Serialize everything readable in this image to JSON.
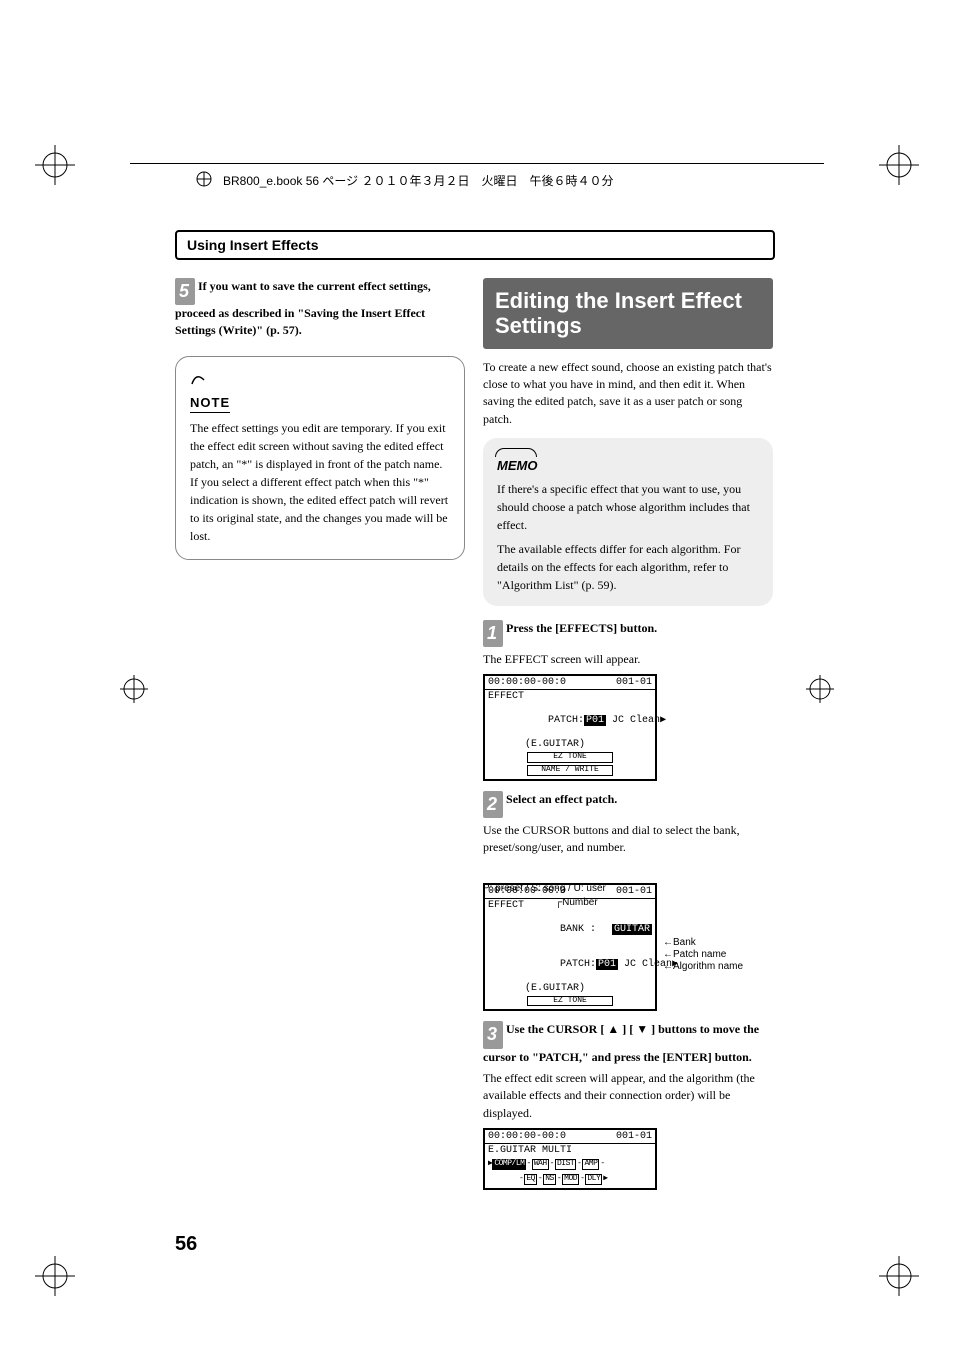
{
  "print_header": "BR800_e.book 56 ページ ２０１０年３月２日　火曜日　午後６時４０分",
  "section_header": "Using Insert Effects",
  "page_number": "56",
  "left": {
    "step5_num": "5",
    "step5_text": "If you want to save the current effect settings, proceed as described in \"Saving the Insert Effect Settings (Write)\" (p. 57).",
    "note_label": "NOTE",
    "note_text": "The effect settings you edit are temporary. If you exit the effect edit screen without saving the edited effect patch, an \"*\" is displayed in front of the patch name. If you select a different effect patch when this \"*\" indication is shown, the edited effect patch will revert to its original state, and the changes you made will be lost."
  },
  "right": {
    "title": "Editing the Insert Effect Settings",
    "intro": "To create a new effect sound, choose an existing patch that's close to what you have in mind, and then edit it. When saving the edited patch, save it as a user patch or song patch.",
    "memo_label": "MEMO",
    "memo_p1": "If there's a specific effect that you want to use, you should choose a patch whose algorithm includes that effect.",
    "memo_p2": "The available effects differ for each algorithm. For details on the effects for each algorithm, refer to \"Algorithm List\" (p. 59).",
    "step1_num": "1",
    "step1_bold": "Press the [EFFECTS] button.",
    "step1_text": "The EFFECT screen will appear.",
    "lcd1": {
      "top_left": "00:00:00-00:0",
      "top_right": "001-01",
      "l2": "EFFECT",
      "l3a": "PATCH:",
      "l3b": "P01",
      "l3c": " JC Clean",
      "l4": "(E.GUITAR)",
      "btn1": "EZ TONE",
      "btn2": "NAME / WRITE"
    },
    "step2_num": "2",
    "step2_bold": "Select an effect patch.",
    "step2_text": "Use the CURSOR buttons and dial to select the bank, preset/song/user, and number.",
    "anno_top": "P: preset / S: song / U: user",
    "anno_number": "Number",
    "anno_bank": "Bank",
    "anno_patch": "Patch name",
    "anno_algo": "Algorithm name",
    "lcd2": {
      "top_left": "00:00:00-00:0",
      "top_right": "001-01",
      "l2": "EFFECT",
      "l3a": "BANK :",
      "l3b": "GUITAR",
      "l4a": "PATCH:",
      "l4b": "P01",
      "l4c": " JC Clean",
      "l5": "(E.GUITAR)",
      "btn1": "EZ TONE"
    },
    "step3_num": "3",
    "step3_bold_a": "Use the CURSOR [ ",
    "step3_bold_b": " ] [ ",
    "step3_bold_c": " ] buttons to move the cursor to \"PATCH,\" and press the [ENTER] button.",
    "step3_text": "The effect edit screen will appear, and the algorithm (the available effects and their connection order) will be displayed.",
    "lcd3": {
      "top_left": "00:00:00-00:0",
      "top_right": "001-01",
      "l2": "E.GUITAR MULTI",
      "chain1": [
        "COMP/LM",
        "WAH",
        "DIST",
        "AMP"
      ],
      "chain2": [
        "EQ",
        "NS",
        "MOD",
        "DLY"
      ]
    }
  }
}
